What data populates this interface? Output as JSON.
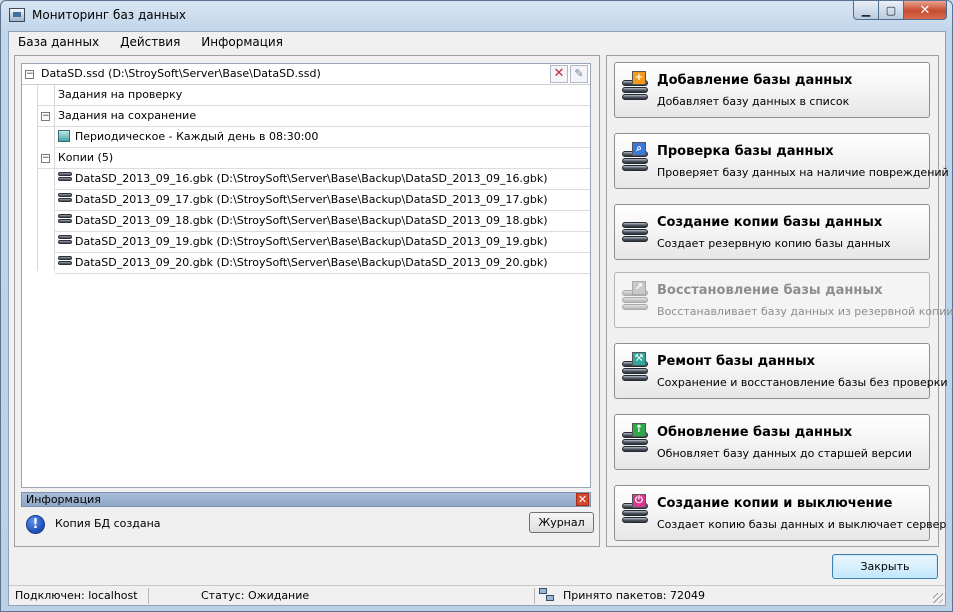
{
  "window": {
    "title": "Мониторинг баз данных"
  },
  "menu": [
    "База данных",
    "Действия",
    "Информация"
  ],
  "tree": {
    "root": "DataSD.ssd (D:\\StroySoft\\Server\\Base\\DataSD.ssd)",
    "check_tasks": "Задания на проверку",
    "save_tasks": "Задания на сохранение",
    "periodic": "Периодическое - Каждый день в 08:30:00",
    "copies_label": "Копии (5)",
    "copies": [
      "DataSD_2013_09_16.gbk (D:\\StroySoft\\Server\\Base\\Backup\\DataSD_2013_09_16.gbk)",
      "DataSD_2013_09_17.gbk (D:\\StroySoft\\Server\\Base\\Backup\\DataSD_2013_09_17.gbk)",
      "DataSD_2013_09_18.gbk (D:\\StroySoft\\Server\\Base\\Backup\\DataSD_2013_09_18.gbk)",
      "DataSD_2013_09_19.gbk (D:\\StroySoft\\Server\\Base\\Backup\\DataSD_2013_09_19.gbk)",
      "DataSD_2013_09_20.gbk (D:\\StroySoft\\Server\\Base\\Backup\\DataSD_2013_09_20.gbk)"
    ]
  },
  "info": {
    "header": "Информация",
    "message": "Копия БД создана",
    "journal_button": "Журнал"
  },
  "actions": [
    {
      "title": "Добавление базы данных",
      "desc": "Добавляет базу данных в список",
      "badge": "+",
      "badge_color": "#f39a1e",
      "enabled": true
    },
    {
      "title": "Проверка базы данных",
      "desc": "Проверяет базу данных на наличие повреждений",
      "badge": "⌕",
      "badge_color": "#3d78d8",
      "enabled": true
    },
    {
      "title": "Создание копии базы данных",
      "desc": "Создает резервную копию базы данных",
      "badge": "",
      "badge_color": "",
      "enabled": true
    },
    {
      "title": "Восстановление базы данных",
      "desc": "Восстанавливает базу данных из резервной копии",
      "badge": "↗",
      "badge_color": "#c9c9c9",
      "enabled": false
    },
    {
      "title": "Ремонт базы данных",
      "desc": "Сохранение и восстановление базы без проверки",
      "badge": "⚒",
      "badge_color": "#2fa6a0",
      "enabled": true
    },
    {
      "title": "Обновление базы данных",
      "desc": "Обновляет базу данных до старшей версии",
      "badge": "↑",
      "badge_color": "#2fa84a",
      "enabled": true
    },
    {
      "title": "Создание копии и выключение",
      "desc": "Создает копию базы данных и выключает сервер",
      "badge": "⏻",
      "badge_color": "#d8398f",
      "enabled": true
    }
  ],
  "close_button": "Закрыть",
  "status": {
    "connected": "Подключен: localhost",
    "state": "Статус: Ожидание",
    "packets": "Принято пакетов: 72049"
  }
}
